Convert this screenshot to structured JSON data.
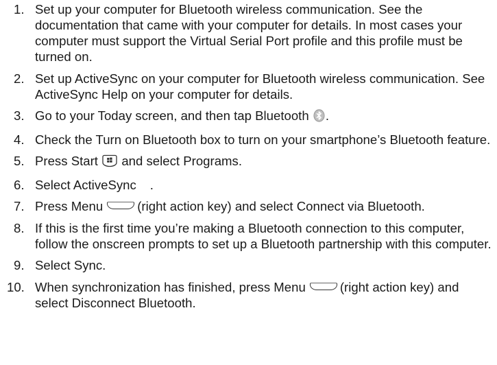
{
  "steps": [
    {
      "num": "1.",
      "text": "Set up your computer for Bluetooth wireless communication. See the documentation that came with your computer for details. In most cases your computer must support the Virtual Serial Port profile and this profile must be turned on."
    },
    {
      "num": "2.",
      "text": "Set up ActiveSync on your computer for Bluetooth wireless communication. See ActiveSync Help on your computer for details."
    },
    {
      "num": "3.",
      "text_a": "Go to your Today screen, and then tap Bluetooth",
      "text_b": "."
    },
    {
      "num": "4.",
      "text": "Check the Turn on Bluetooth box to turn on your smartphone’s Bluetooth feature."
    },
    {
      "num": "5.",
      "text_a": "Press Start",
      "text_b": "and select Programs."
    },
    {
      "num": "6.",
      "text_a": "Select ActiveSync",
      "text_b": "."
    },
    {
      "num": "7.",
      "text_a": "Press Menu",
      "text_b": "(right action key) and select Connect via Bluetooth."
    },
    {
      "num": "8.",
      "text": "If this is the first time you’re making a Bluetooth connection to this computer, follow the onscreen prompts to set up a Bluetooth partnership with this computer."
    },
    {
      "num": "9.",
      "text": "Select Sync."
    },
    {
      "num": "10.",
      "text_a": "When synchronization has finished, press Menu",
      "text_b": "(right action key) and select Disconnect Bluetooth."
    }
  ],
  "icons": {
    "bluetooth": "bluetooth-icon",
    "start": "windows-start-icon",
    "menu_key": "right-softkey-icon"
  }
}
